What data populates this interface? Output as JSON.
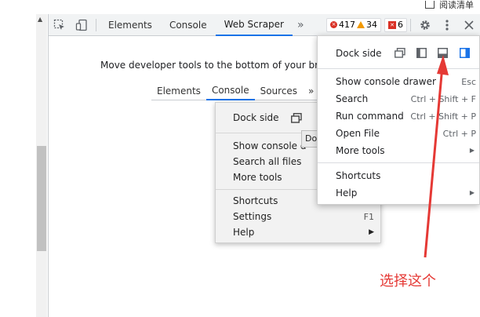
{
  "top_strip": {
    "reading_list_label": "阅读清单"
  },
  "toolbar": {
    "tabs": [
      "Elements",
      "Console",
      "Web Scraper"
    ],
    "active_tab": "Web Scraper",
    "overflow_chevron": "»",
    "errors": "417",
    "warnings": "34",
    "issues": "6"
  },
  "panel": {
    "message": "Move developer tools to the bottom of your browser"
  },
  "inner_screenshot": {
    "tabs": [
      "Elements",
      "Console",
      "Sources"
    ],
    "overflow_chevron": "»",
    "tooltip": "Do",
    "menu": {
      "dock_side": "Dock side",
      "show_console": "Show console d",
      "search_all_files": "Search all files",
      "more_tools": "More tools",
      "shortcuts": "Shortcuts",
      "settings": "Settings",
      "settings_shortcut": "F1",
      "help": "Help"
    }
  },
  "menu": {
    "dock_side": "Dock side",
    "show_console_drawer": "Show console drawer",
    "show_console_drawer_shortcut": "Esc",
    "search": "Search",
    "search_shortcut": "Ctrl + Shift + F",
    "run_command": "Run command",
    "run_command_shortcut": "Ctrl + Shift + P",
    "open_file": "Open File",
    "open_file_shortcut": "Ctrl + P",
    "more_tools": "More tools",
    "shortcuts": "Shortcuts",
    "help": "Help"
  },
  "annotation": {
    "text": "选择这个",
    "color": "#e53935"
  }
}
